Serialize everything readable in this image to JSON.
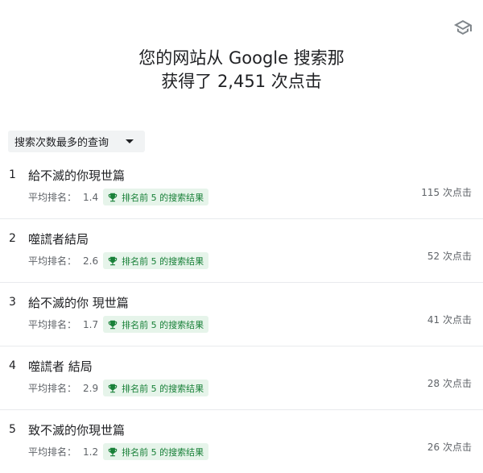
{
  "header": {
    "title_line1": "您的网站从 Google 搜索那",
    "title_line2": "获得了 2,451 次点击",
    "learn_icon": "school-icon"
  },
  "dropdown": {
    "label": "搜索次数最多的查询",
    "icon": "arrow-drop-down-icon"
  },
  "queries": [
    {
      "rank": "1",
      "text": "給不滅的你現世篇",
      "avg_label": "平均排名：",
      "position": "1.4",
      "badge": "排名前 5 的搜索结果",
      "clicks": "115 次点击"
    },
    {
      "rank": "2",
      "text": "噬謊者結局",
      "avg_label": "平均排名：",
      "position": "2.6",
      "badge": "排名前 5 的搜索结果",
      "clicks": "52 次点击"
    },
    {
      "rank": "3",
      "text": "給不滅的你 現世篇",
      "avg_label": "平均排名：",
      "position": "1.7",
      "badge": "排名前 5 的搜索结果",
      "clicks": "41 次点击"
    },
    {
      "rank": "4",
      "text": "噬謊者 結局",
      "avg_label": "平均排名：",
      "position": "2.9",
      "badge": "排名前 5 的搜索结果",
      "clicks": "28 次点击"
    },
    {
      "rank": "5",
      "text": "致不滅的你現世篇",
      "avg_label": "平均排名：",
      "position": "1.2",
      "badge": "排名前 5 的搜索结果",
      "clicks": "26 次点击"
    }
  ],
  "colors": {
    "badge_bg": "#e6f4ea",
    "badge_text": "#188038",
    "trophy": "#188038"
  }
}
